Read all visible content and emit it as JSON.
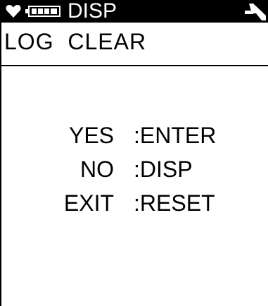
{
  "status_bar": {
    "title": "DISP",
    "icons": {
      "left": "heart-icon",
      "battery": "battery-icon",
      "right": "signal-icon"
    }
  },
  "screen": {
    "title": "LOG  CLEAR"
  },
  "options": [
    {
      "key": "YES",
      "action": ":ENTER"
    },
    {
      "key": "NO",
      "action": ":DISP"
    },
    {
      "key": "EXIT",
      "action": ":RESET"
    }
  ],
  "colors": {
    "background": "#ffffff",
    "foreground": "#000000",
    "status_bar_bg": "#000000",
    "status_bar_fg": "#ffffff"
  }
}
